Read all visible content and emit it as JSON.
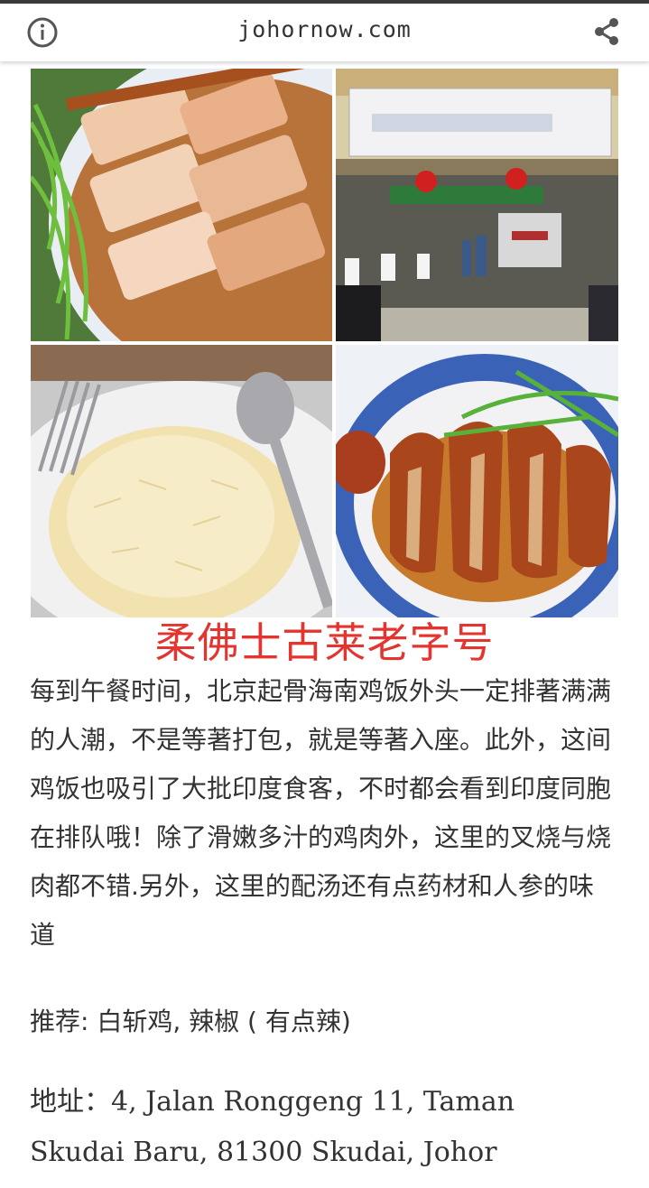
{
  "header": {
    "site_title": "johornow.com",
    "info_icon": "info-icon",
    "share_icon": "share-icon"
  },
  "gallery": {
    "images": [
      {
        "name": "roast-pork-photo"
      },
      {
        "name": "restaurant-storefront-photo"
      },
      {
        "name": "chicken-rice-photo"
      },
      {
        "name": "soy-sauce-chicken-photo"
      }
    ]
  },
  "article": {
    "headline": "柔佛士古莱老字号",
    "description": "每到午餐时间，北京起骨海南鸡饭外头一定排著满满的人潮，不是等著打包，就是等著入座。此外，这间鸡饭也吸引了大批印度食客，不时都会看到印度同胞在排队哦！除了滑嫩多汁的鸡肉外，这里的叉烧与烧肉都不错.另外，这里的配汤还有点药材和人参的味道",
    "recommendation": "推荐: 白斩鸡, 辣椒 ( 有点辣)",
    "address": "地址：4, Jalan Ronggeng 11, Taman Skudai Baru, 81300 Skudai, Johor"
  },
  "colors": {
    "headline": "#e3342f",
    "body_text": "#333333"
  }
}
